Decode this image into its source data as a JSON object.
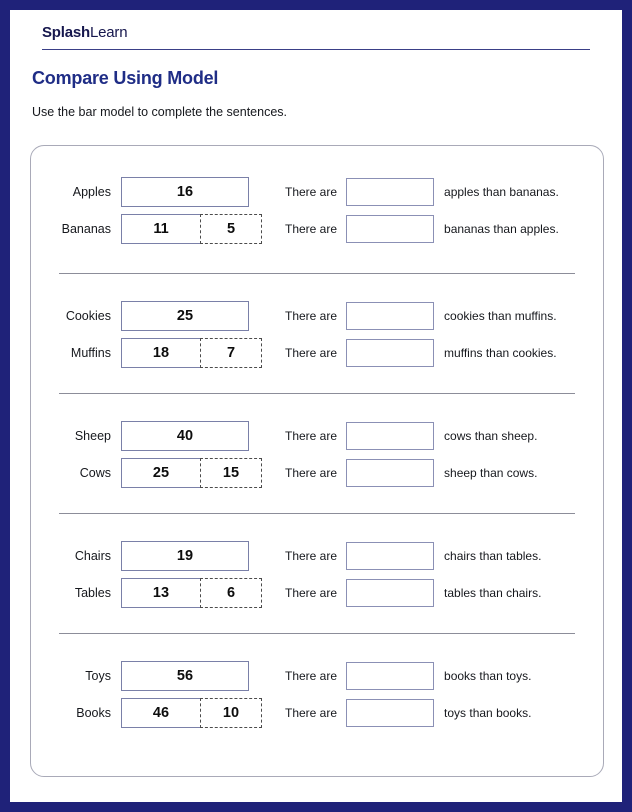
{
  "brand": {
    "logo_bold": "Splash",
    "logo_light": "Learn"
  },
  "worksheet": {
    "title": "Compare Using Model",
    "instruction": "Use the bar model to complete the sentences.",
    "there_are_label": "There are"
  },
  "colors": {
    "page_border": "#1f2279",
    "title": "#1f2d86",
    "card_border": "#a9aab8",
    "bar_border": "#7a80a8",
    "dashed_border": "#4c4c4c",
    "answer_box_border": "#8b90b5",
    "divider": "#8c8d99"
  },
  "problems": [
    {
      "total_label": "Apples",
      "total_value": "16",
      "part_label": "Bananas",
      "part_value": "11",
      "diff_value": "5",
      "sentence_1_tail": "apples than bananas.",
      "sentence_2_tail": "bananas than apples.",
      "answer_1": "",
      "answer_2": ""
    },
    {
      "total_label": "Cookies",
      "total_value": "25",
      "part_label": "Muffins",
      "part_value": "18",
      "diff_value": "7",
      "sentence_1_tail": "cookies than muffins.",
      "sentence_2_tail": "muffins than cookies.",
      "answer_1": "",
      "answer_2": ""
    },
    {
      "total_label": "Sheep",
      "total_value": "40",
      "part_label": "Cows",
      "part_value": "25",
      "diff_value": "15",
      "sentence_1_tail": "cows than sheep.",
      "sentence_2_tail": "sheep than cows.",
      "answer_1": "",
      "answer_2": ""
    },
    {
      "total_label": "Chairs",
      "total_value": "19",
      "part_label": "Tables",
      "part_value": "13",
      "diff_value": "6",
      "sentence_1_tail": "chairs than tables.",
      "sentence_2_tail": "tables than chairs.",
      "answer_1": "",
      "answer_2": ""
    },
    {
      "total_label": "Toys",
      "total_value": "56",
      "part_label": "Books",
      "part_value": "46",
      "diff_value": "10",
      "sentence_1_tail": "books than toys.",
      "sentence_2_tail": "toys than books.",
      "answer_1": "",
      "answer_2": ""
    }
  ]
}
